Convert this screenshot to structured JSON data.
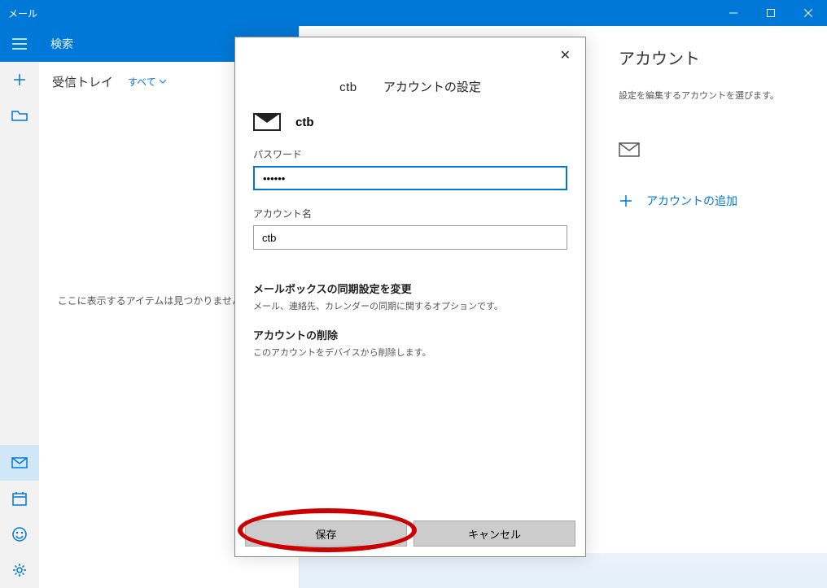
{
  "titlebar": {
    "title": "メール"
  },
  "search": {
    "placeholder": "検索"
  },
  "inbox": {
    "title": "受信トレイ",
    "filter": "すべて",
    "empty_text": "ここに表示するアイテムは見つかりませんでした。"
  },
  "accounts_panel": {
    "heading": "アカウント",
    "hint": "設定を編集するアカウントを選びます。",
    "add_label": "アカウントの追加"
  },
  "dialog": {
    "account_id": "ctb",
    "title": "アカウントの設定",
    "account_label": "ctb",
    "password_label": "パスワード",
    "password_value": "••••••",
    "account_name_label": "アカウント名",
    "account_name_value": "ctb",
    "sync_title": "メールボックスの同期設定を変更",
    "sync_desc": "メール、連絡先、カレンダーの同期に関するオプションです。",
    "delete_title": "アカウントの削除",
    "delete_desc": "このアカウントをデバイスから削除します。",
    "save_label": "保存",
    "cancel_label": "キャンセル"
  }
}
